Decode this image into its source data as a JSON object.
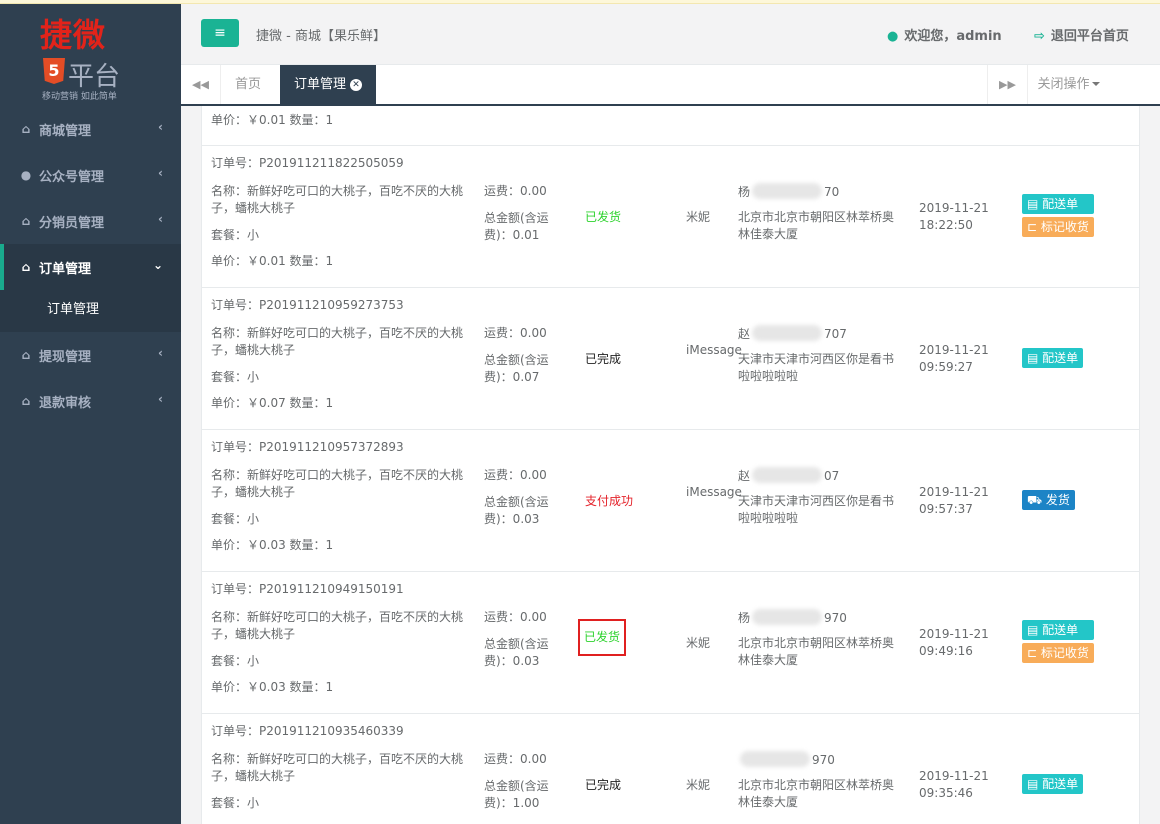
{
  "brand": {
    "title": "捷微",
    "sub": "平台",
    "badge": "5",
    "tagline": "移动营销 如此简单"
  },
  "sidebar": {
    "items": [
      {
        "label": "商城管理",
        "arrow": "‹"
      },
      {
        "label": "公众号管理",
        "arrow": "‹"
      },
      {
        "label": "分销员管理",
        "arrow": "‹"
      },
      {
        "label": "订单管理",
        "arrow": "⌄"
      },
      {
        "label": "提现管理",
        "arrow": "‹"
      },
      {
        "label": "退款审核",
        "arrow": "‹"
      }
    ],
    "subitem": "订单管理"
  },
  "header": {
    "menu_icon": "≡",
    "site_title": "捷微 - 商城【果乐鲜】",
    "welcome": "欢迎您，admin",
    "back": "退回平台首页"
  },
  "tabs": {
    "home": "首页",
    "current": "订单管理",
    "close_ops": "关闭操作"
  },
  "top_row": {
    "price": "单价：￥0.01 数量：1"
  },
  "orders": [
    {
      "order_no": "订单号：P201911211822505059",
      "name": "名称：新鲜好吃可口的大桃子，百吃不厌的大桃子，蟠桃大桃子",
      "pkg": "套餐：小",
      "price": "单价：￥0.01 数量：1",
      "ship": "运费：0.00",
      "total": "总金额(含运费)：0.01",
      "status": "已发货",
      "buyer": "米妮",
      "phone_a": "杨",
      "phone_b": "70",
      "addr": "北京市北京市朝阳区林萃桥奥林佳泰大厦",
      "time": "2019-11-21 18:22:50",
      "btn1": "配送单",
      "btn2": "标记收货"
    },
    {
      "order_no": "订单号：P201911210959273753",
      "name": "名称：新鲜好吃可口的大桃子，百吃不厌的大桃子，蟠桃大桃子",
      "pkg": "套餐：小",
      "price": "单价：￥0.07 数量：1",
      "ship": "运费：0.00",
      "total": "总金额(含运费)：0.07",
      "status": "已完成",
      "buyer": "iMessage",
      "phone_a": "赵",
      "phone_b": "707",
      "addr": "天津市天津市河西区你是看书啦啦啦啦啦",
      "time": "2019-11-21 09:59:27",
      "btn1": "配送单"
    },
    {
      "order_no": "订单号：P201911210957372893",
      "name": "名称：新鲜好吃可口的大桃子，百吃不厌的大桃子，蟠桃大桃子",
      "pkg": "套餐：小",
      "price": "单价：￥0.03 数量：1",
      "ship": "运费：0.00",
      "total": "总金额(含运费)：0.03",
      "status": "支付成功",
      "buyer": "iMessage",
      "phone_a": "赵",
      "phone_b": "07",
      "addr": "天津市天津市河西区你是看书啦啦啦啦啦",
      "time": "2019-11-21 09:57:37",
      "btn1": "发货"
    },
    {
      "order_no": "订单号：P201911210949150191",
      "name": "名称：新鲜好吃可口的大桃子，百吃不厌的大桃子，蟠桃大桃子",
      "pkg": "套餐：小",
      "price": "单价：￥0.03 数量：1",
      "ship": "运费：0.00",
      "total": "总金额(含运费)：0.03",
      "status": "已发货",
      "buyer": "米妮",
      "phone_a": "杨",
      "phone_b": "970",
      "addr": "北京市北京市朝阳区林萃桥奥林佳泰大厦",
      "time": "2019-11-21 09:49:16",
      "btn1": "配送单",
      "btn2": "标记收货"
    },
    {
      "order_no": "订单号：P201911210935460339",
      "name": "名称：新鲜好吃可口的大桃子，百吃不厌的大桃子，蟠桃大桃子",
      "pkg": "套餐：小",
      "price": "",
      "ship": "运费：0.00",
      "total": "总金额(含运费)：1.00",
      "status": "已完成",
      "buyer": "米妮",
      "phone_a": "",
      "phone_b": "970",
      "addr": "北京市北京市朝阳区林萃桥奥林佳泰大厦",
      "time": "2019-11-21 09:35:46",
      "btn1": "配送单"
    }
  ],
  "colors": {
    "sidebar": "#2f4050",
    "accent": "#1ab394",
    "status_shipped": "#2ed32e",
    "status_paid": "#e4222a"
  }
}
